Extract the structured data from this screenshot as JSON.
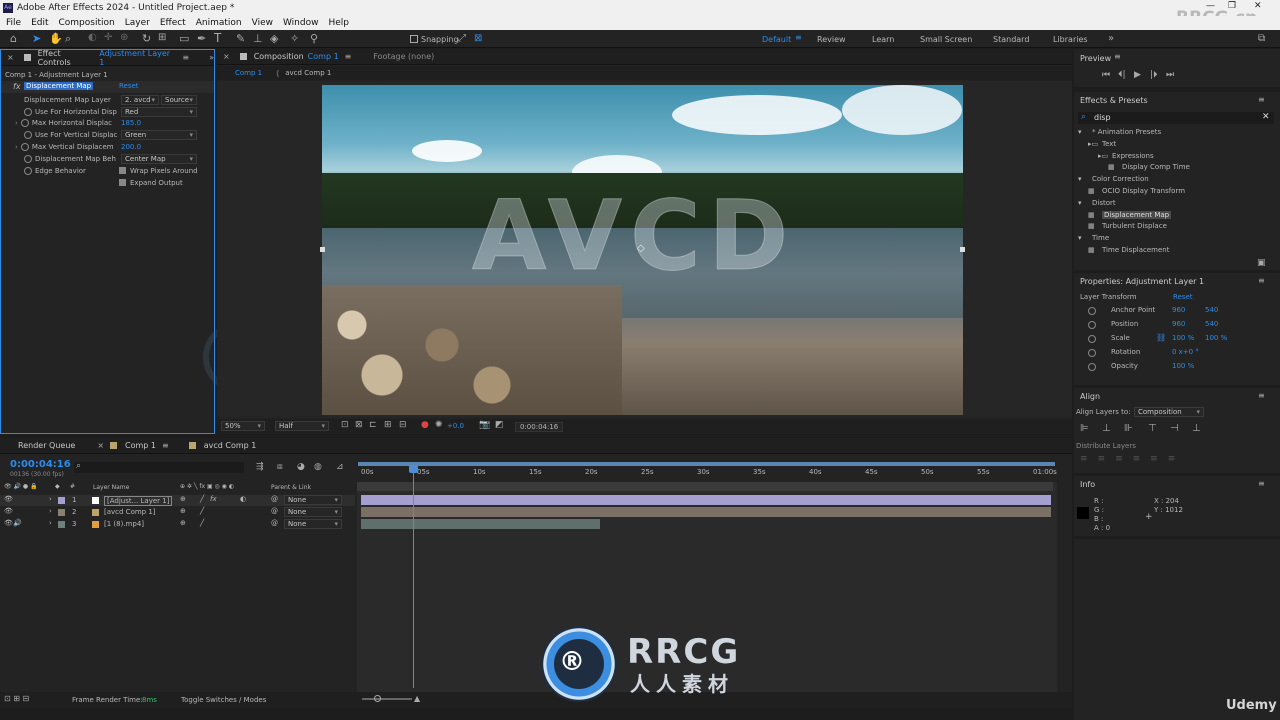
{
  "app": {
    "title": "Adobe After Effects 2024 - Untitled Project.aep *",
    "watermark": "RRCG.cn"
  },
  "menu": [
    "File",
    "Edit",
    "Composition",
    "Layer",
    "Effect",
    "Animation",
    "View",
    "Window",
    "Help"
  ],
  "toolbar": {
    "snapping": "Snapping",
    "workspaces": [
      "Default",
      "Review",
      "Learn",
      "Small Screen",
      "Standard",
      "Libraries"
    ]
  },
  "effect_controls": {
    "tab": "Effect Controls",
    "tab_layer": "Adjustment Layer 1",
    "subtitle": "Comp 1 - Adjustment Layer 1",
    "effect_name": "Displacement Map",
    "reset": "Reset",
    "props": [
      {
        "label": "Displacement Map Layer",
        "value": "2. avcd",
        "value2": "Source"
      },
      {
        "label": "Use For Horizontal Disp",
        "value": "Red"
      },
      {
        "label": "Max Horizontal Displac",
        "value": "185.0"
      },
      {
        "label": "Use For Vertical Displac",
        "value": "Green"
      },
      {
        "label": "Max Vertical Displacem",
        "value": "200.0"
      },
      {
        "label": "Displacement Map Beh",
        "value": "Center Map"
      },
      {
        "label": "Edge Behavior",
        "value": "Wrap Pixels Around"
      },
      {
        "label": "",
        "value": "Expand Output"
      }
    ]
  },
  "composition": {
    "tab": "Composition",
    "tab_comp": "Comp 1",
    "footage": "Footage (none)",
    "breadcrumbs": [
      "Comp 1",
      "avcd Comp 1"
    ],
    "overlay_text": "AVCD",
    "zoom": "50%",
    "resolution": "Half",
    "exposure": "+0.0",
    "time": "0:00:04:16"
  },
  "preview": {
    "title": "Preview"
  },
  "effects_presets": {
    "title": "Effects & Presets",
    "search": "disp",
    "tree": [
      {
        "label": "* Animation Presets",
        "level": 0
      },
      {
        "label": "Text",
        "level": 1
      },
      {
        "label": "Expressions",
        "level": 2
      },
      {
        "label": "Display Comp Time",
        "level": 3
      },
      {
        "label": "Color Correction",
        "level": 0
      },
      {
        "label": "OCIO Display Transform",
        "level": 1
      },
      {
        "label": "Distort",
        "level": 0
      },
      {
        "label": "Displacement Map",
        "level": 1,
        "selected": true
      },
      {
        "label": "Turbulent Displace",
        "level": 1
      },
      {
        "label": "Time",
        "level": 0
      },
      {
        "label": "Time Displacement",
        "level": 1
      }
    ]
  },
  "properties": {
    "title": "Properties: Adjustment Layer 1",
    "section": "Layer Transform",
    "reset": "Reset",
    "rows": [
      {
        "label": "Anchor Point",
        "v1": "960",
        "v2": "540"
      },
      {
        "label": "Position",
        "v1": "960",
        "v2": "540"
      },
      {
        "label": "Scale",
        "v1": "100 %",
        "v2": "100 %"
      },
      {
        "label": "Rotation",
        "v1": "0 x+0 °",
        "v2": ""
      },
      {
        "label": "Opacity",
        "v1": "100 %",
        "v2": ""
      }
    ]
  },
  "align": {
    "title": "Align",
    "align_to_label": "Align Layers to:",
    "align_to": "Composition",
    "distribute": "Distribute Layers"
  },
  "info": {
    "title": "Info",
    "r": "R :",
    "g": "G :",
    "b": "B :",
    "a": "A :  0",
    "x": "X : 204",
    "y": "Y : 1012"
  },
  "timeline": {
    "tabs": [
      "Render Queue",
      "Comp 1",
      "avcd Comp 1"
    ],
    "timecode": "0:00:04:16",
    "frames": "00136 (30.00 fps)",
    "col_layer": "Layer Name",
    "col_parent": "Parent & Link",
    "ruler": [
      "00s",
      "05s",
      "10s",
      "15s",
      "20s",
      "25s",
      "30s",
      "35s",
      "40s",
      "45s",
      "50s",
      "55s",
      "01:00s"
    ],
    "layers": [
      {
        "num": "1",
        "name": "[Adjust... Layer 1]",
        "parent": "None",
        "color": "#a59fd0"
      },
      {
        "num": "2",
        "name": "[avcd Comp 1]",
        "parent": "None",
        "color": "#8a7f70"
      },
      {
        "num": "3",
        "name": "[1 (8).mp4]",
        "parent": "None",
        "color": "#6e7f7c"
      }
    ],
    "footer_label": "Frame Render Time:",
    "footer_value": "8ms",
    "toggle": "Toggle Switches / Modes"
  },
  "brand": {
    "big": "RRCG",
    "sub": "人人素材",
    "udemy": "Udemy"
  }
}
